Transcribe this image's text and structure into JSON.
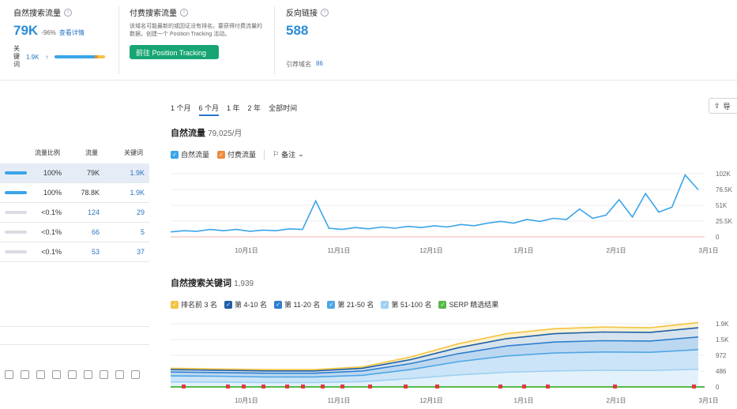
{
  "cards": {
    "organic": {
      "title": "自然搜索流量",
      "value": "79K",
      "change": "-96%",
      "link": "查看详情",
      "kw_label": "关键词",
      "kw_value": "1.9K",
      "kw_arrow": "↑"
    },
    "paid": {
      "title": "付费搜索流量",
      "desc": "该域名可能最新的或因证没有排名。要获得付费流量的数据，创建一个 Position Tracking 活动。",
      "button": "前往 Position Tracking"
    },
    "backlinks": {
      "title": "反向链接",
      "value": "588",
      "ref_label": "引荐域名",
      "ref_value": "86"
    }
  },
  "left_table": {
    "headers": [
      "流量比例",
      "流量",
      "关键词"
    ],
    "rows": [
      {
        "pct": "100%",
        "traffic": "79K",
        "kw": "1.9K",
        "bar_color": "#3aa5e8",
        "bar_fill": 1.0
      },
      {
        "pct": "100%",
        "traffic": "78.8K",
        "kw": "1.9K",
        "bar_color": "#3aa5e8",
        "bar_fill": 1.0
      },
      {
        "pct": "<0.1%",
        "traffic": "124",
        "kw": "29",
        "bar_color": "#d9dde3",
        "bar_fill": 0.0
      },
      {
        "pct": "<0.1%",
        "traffic": "66",
        "kw": "5",
        "bar_color": "#d9dde3",
        "bar_fill": 0.0
      },
      {
        "pct": "<0.1%",
        "traffic": "53",
        "kw": "37",
        "bar_color": "#d9dde3",
        "bar_fill": 0.0
      }
    ]
  },
  "bottom_icons": [
    "circle-icon",
    "play-icon",
    "circle-dot-icon",
    "comment-icon",
    "pin-icon",
    "cap-icon",
    "doc-icon",
    "store-icon",
    "x-logo-icon"
  ],
  "time_tabs": [
    "1 个月",
    "6 个月",
    "1 年",
    "2 年",
    "全部时间"
  ],
  "active_tab": 1,
  "export_label": "导",
  "traffic_chart": {
    "title": "自然流量",
    "subtitle": "79,025/月",
    "legend": [
      {
        "label": "自然流量",
        "color": "#3aa5e8",
        "checked": true
      },
      {
        "label": "付费流量",
        "color": "#f08a3c",
        "checked": true
      }
    ],
    "notes_label": "备注",
    "y_ticks": [
      "102K",
      "76.5K",
      "51K",
      "25.5K",
      "0"
    ],
    "x_ticks": [
      "10月1日",
      "11月1日",
      "12月1日",
      "1月1日",
      "2月1日",
      "3月1日"
    ]
  },
  "keywords_chart": {
    "title": "自然搜索关键词",
    "subtitle": "1,939",
    "legend": [
      {
        "label": "排名前 3 名",
        "color": "#f5c342"
      },
      {
        "label": "第 4-10 名",
        "color": "#1f5fa8"
      },
      {
        "label": "第 11-20 名",
        "color": "#2f7fcf"
      },
      {
        "label": "第 21-50 名",
        "color": "#4fa6e5"
      },
      {
        "label": "第 51-100 名",
        "color": "#9fd0f2"
      },
      {
        "label": "SERP 精选结果",
        "color": "#58b84a"
      }
    ],
    "y_ticks": [
      "1.9K",
      "1.5K",
      "972",
      "486",
      "0"
    ],
    "x_ticks": [
      "10月1日",
      "11月1日",
      "12月1日",
      "1月1日",
      "2月1日",
      "3月1日"
    ]
  },
  "chart_data": [
    {
      "type": "line",
      "title": "自然流量",
      "ylim": [
        0,
        102000
      ],
      "x": [
        "10月1日",
        "11月1日",
        "12月1日",
        "1月1日",
        "2月1日",
        "3月1日"
      ],
      "series": [
        {
          "name": "自然流量",
          "values": [
            8000,
            10000,
            9000,
            12000,
            10000,
            12000,
            9000,
            11000,
            10000,
            13000,
            12000,
            58000,
            14000,
            12000,
            15000,
            13000,
            16000,
            14000,
            17000,
            15000,
            18000,
            16000,
            20000,
            18000,
            22000,
            25000,
            22000,
            28000,
            25000,
            30000,
            28000,
            45000,
            30000,
            35000,
            60000,
            32000,
            70000,
            40000,
            48000,
            100000,
            76000
          ]
        }
      ]
    },
    {
      "type": "area",
      "title": "自然搜索关键词",
      "ylim": [
        0,
        1900
      ],
      "x": [
        "10月1日",
        "11月1日",
        "12月1日",
        "1月1日",
        "2月1日",
        "3月1日"
      ],
      "series": [
        {
          "name": "排名前 3 名",
          "values": [
            560,
            540,
            520,
            520,
            600,
            900,
            1300,
            1600,
            1750,
            1800,
            1780,
            1939
          ]
        },
        {
          "name": "第 4-10 名",
          "values": [
            520,
            500,
            480,
            480,
            560,
            820,
            1180,
            1450,
            1600,
            1650,
            1640,
            1780
          ]
        },
        {
          "name": "第 11-20 名",
          "values": [
            450,
            430,
            410,
            410,
            480,
            700,
            1000,
            1230,
            1350,
            1390,
            1380,
            1500
          ]
        },
        {
          "name": "第 21-50 名",
          "values": [
            330,
            320,
            300,
            300,
            350,
            520,
            760,
            930,
            1020,
            1050,
            1040,
            1120
          ]
        },
        {
          "name": "第 51-100 名",
          "values": [
            150,
            140,
            130,
            130,
            160,
            250,
            360,
            440,
            480,
            500,
            495,
            530
          ]
        }
      ]
    }
  ]
}
